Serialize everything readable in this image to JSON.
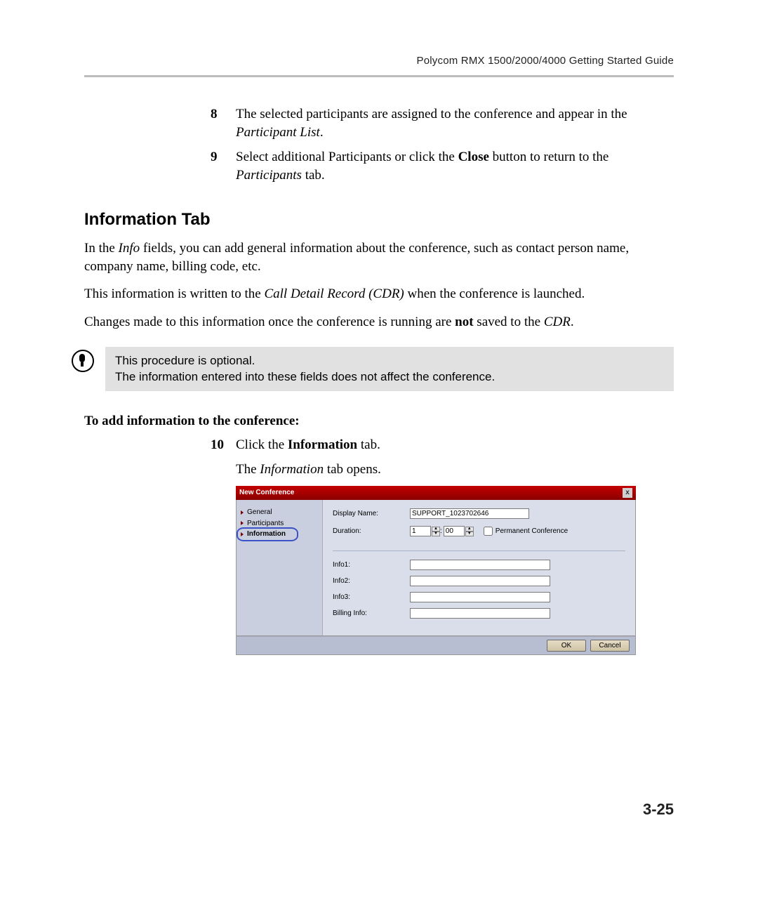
{
  "header": {
    "title": "Polycom RMX 1500/2000/4000 Getting Started Guide"
  },
  "steps": {
    "s8": {
      "num": "8",
      "text_a": "The selected participants are assigned to the conference and appear in the ",
      "italic": "Participant List",
      "text_b": "."
    },
    "s9": {
      "num": "9",
      "text_a": "Select additional Participants or click the ",
      "bold": "Close",
      "text_b": " button to return to the ",
      "italic": "Participants",
      "text_c": " tab."
    },
    "s10": {
      "num": "10",
      "text_a": "Click the ",
      "bold": "Information",
      "text_b": " tab."
    }
  },
  "section": {
    "heading": "Information Tab"
  },
  "paras": {
    "p1_a": "In the ",
    "p1_italic": "Info",
    "p1_b": " fields, you can add general information about the conference, such as contact person name, company name, billing code, etc.",
    "p2_a": "This information is written to the ",
    "p2_italic": "Call Detail Record (CDR)",
    "p2_b": " when the conference is launched.",
    "p3_a": "Changes made to this information once the conference is running are ",
    "p3_bold": "not",
    "p3_b": " saved to the ",
    "p3_italic": "CDR",
    "p3_c": "."
  },
  "note": {
    "line1": "This procedure is optional.",
    "line2": "The information entered into these fields does not affect the conference."
  },
  "task": {
    "title": "To add information to the conference:"
  },
  "follow": {
    "a": "The ",
    "italic": "Information",
    "b": " tab opens."
  },
  "dialog": {
    "title": "New Conference",
    "close": "x",
    "side": {
      "general": "General",
      "participants": "Participants",
      "information": "Information"
    },
    "labels": {
      "display_name": "Display Name:",
      "duration": "Duration:",
      "permanent": "Permanent Conference",
      "info1": "Info1:",
      "info2": "Info2:",
      "info3": "Info3:",
      "billing": "Billing Info:"
    },
    "values": {
      "display_name": "SUPPORT_1023702646",
      "hours": "1",
      "minutes": "00",
      "info1": "",
      "info2": "",
      "info3": "",
      "billing": ""
    },
    "buttons": {
      "ok": "OK",
      "cancel": "Cancel"
    }
  },
  "page_number": "3-25"
}
